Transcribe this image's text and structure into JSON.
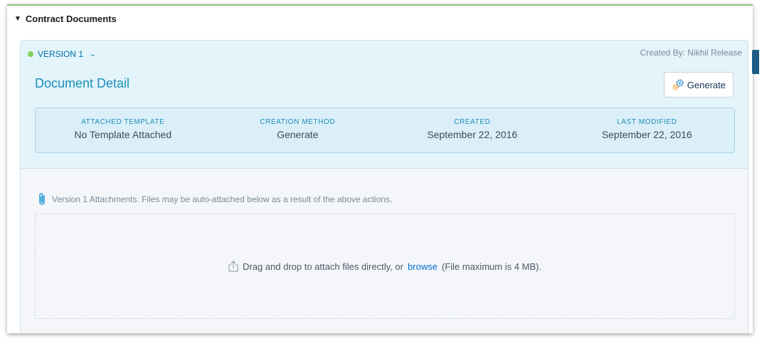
{
  "section": {
    "title": "Contract Documents"
  },
  "version": {
    "label": "VERSION 1",
    "created_by": "Created By: Nikhil Release",
    "status_color": "#7fcf5f"
  },
  "detail": {
    "title": "Document Detail",
    "generate_label": "Generate"
  },
  "meta": [
    {
      "label": "ATTACHED TEMPLATE",
      "value": "No Template Attached"
    },
    {
      "label": "CREATION METHOD",
      "value": "Generate"
    },
    {
      "label": "CREATED",
      "value": "September 22, 2016"
    },
    {
      "label": "LAST MODIFIED",
      "value": "September 22, 2016"
    }
  ],
  "attachments": {
    "note": "Version 1 Attachments. Files may be auto-attached below as a result of the above actions.",
    "drop_text_before": "Drag and drop to attach files directly, or",
    "browse_label": "browse",
    "drop_text_after": "(File maximum is 4 MB)."
  },
  "icons": {
    "section_toggle": "caret-down-icon",
    "version_menu": "chevron-down-icon",
    "generate": "gears-icon",
    "attach": "paperclip-icon",
    "upload": "upload-icon"
  },
  "colors": {
    "accent": "#1b8fb8",
    "link": "#0070d2",
    "panel": "#e3f4fb"
  }
}
